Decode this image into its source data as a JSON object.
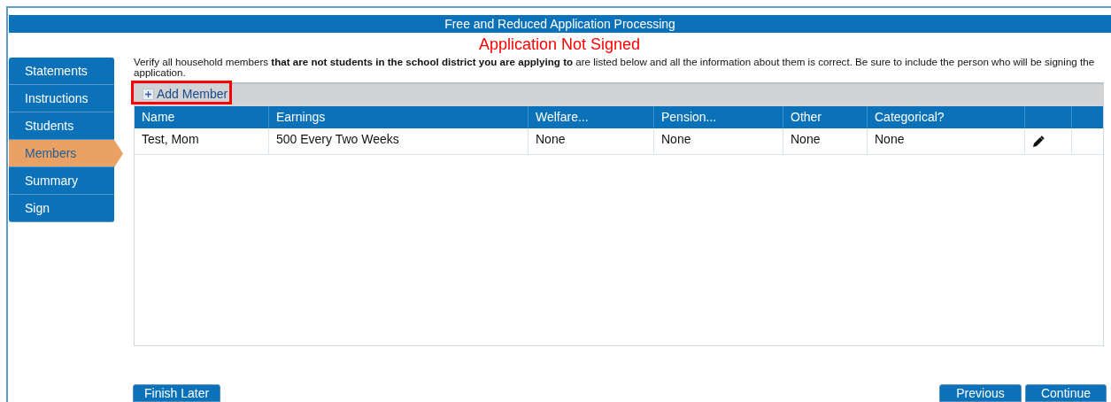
{
  "title": "Free and Reduced Application Processing",
  "status": "Application Not Signed",
  "steps": [
    {
      "label": "Statements",
      "selected": false
    },
    {
      "label": "Instructions",
      "selected": false
    },
    {
      "label": "Students",
      "selected": false
    },
    {
      "label": "Members",
      "selected": true
    },
    {
      "label": "Summary",
      "selected": false
    },
    {
      "label": "Sign",
      "selected": false
    }
  ],
  "instructions": "Verify all household members **that are not students in the school district you are applying to** are listed below and all the information about them is correct. Be sure to include the person who will be signing the application.",
  "toolbar": {
    "add_button": "Add Member",
    "highlighted": true
  },
  "table": {
    "columns": [
      "Name",
      "Earnings",
      "Welfare...",
      "Pension...",
      "Other",
      "Categorical?"
    ],
    "rows": [
      {
        "cells": [
          "Test, Mom",
          "500 Every Two Weeks",
          "None",
          "None",
          "None",
          "None"
        ]
      }
    ]
  },
  "buttons": {
    "finish": "Finish Later",
    "previous": "Previous",
    "continue": "Continue"
  }
}
